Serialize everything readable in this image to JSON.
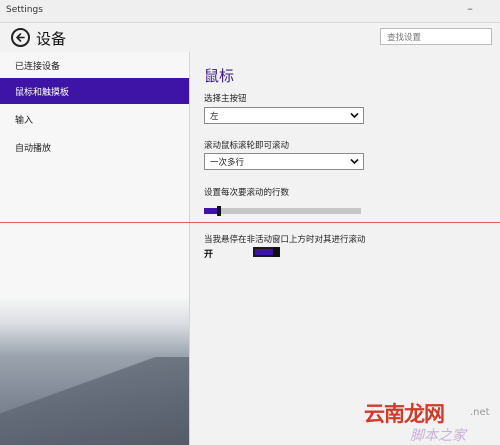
{
  "window": {
    "title": "Settings"
  },
  "header": {
    "back_icon": "back-arrow-icon",
    "title": "设备"
  },
  "search": {
    "placeholder": "查找设置"
  },
  "sidebar": {
    "items": [
      {
        "label": "已连接设备",
        "active": false
      },
      {
        "label": "鼠标和触摸板",
        "active": true
      },
      {
        "label": "输入",
        "active": false
      },
      {
        "label": "自动播放",
        "active": false
      }
    ]
  },
  "main": {
    "section_title": "鼠标",
    "primary_button": {
      "label": "选择主按钮",
      "value": "左"
    },
    "wheel_scroll": {
      "label": "滚动鼠标滚轮即可滚动",
      "value": "一次多行"
    },
    "lines_to_scroll": {
      "label": "设置每次要滚动的行数",
      "level": 0.08
    },
    "inactive_scroll": {
      "label": "当我悬停在非活动窗口上方时对其进行滚动",
      "state": "开",
      "on": true
    }
  },
  "colors": {
    "accent": "#3d14a6",
    "section_title": "#3c1c8e",
    "guide_line": "#e45a62"
  },
  "watermark": {
    "main": "云南龙网",
    "suffix": ".net",
    "sub": "脚本之家"
  }
}
